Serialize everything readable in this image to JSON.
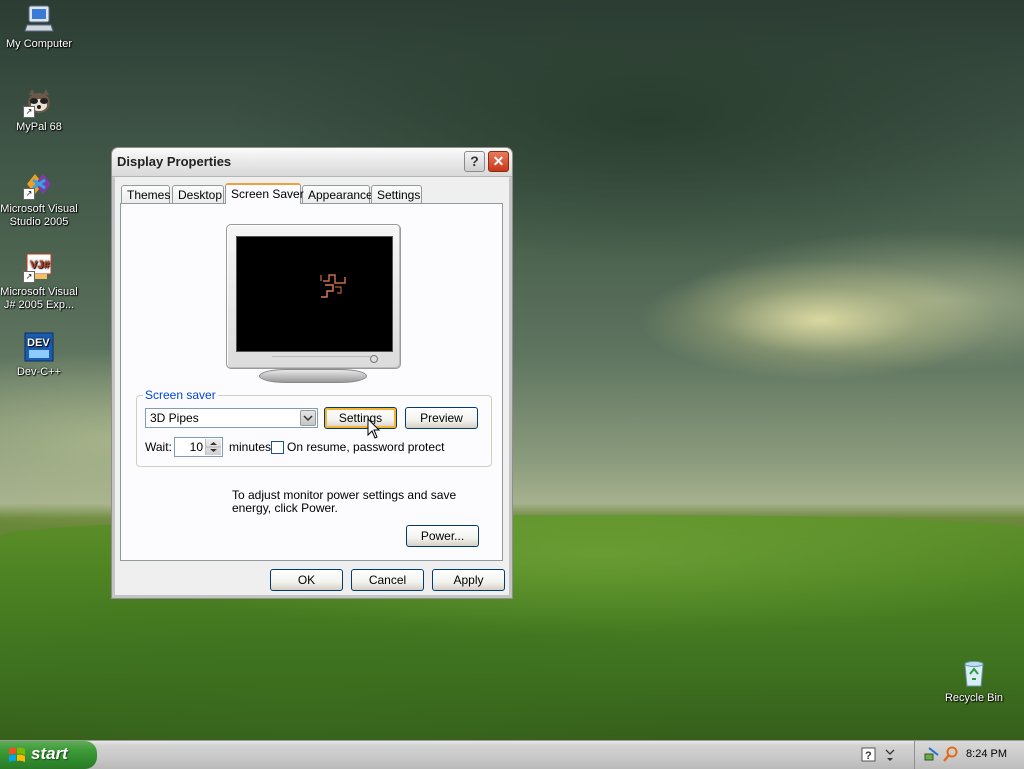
{
  "desktop": {
    "icons": [
      {
        "label": "My Computer",
        "icon": "my-computer-icon"
      },
      {
        "label": "MyPal 68",
        "icon": "mypal-icon"
      },
      {
        "label": "Microsoft Visual Studio 2005",
        "icon": "visual-studio-icon"
      },
      {
        "label": "Microsoft Visual J# 2005 Exp...",
        "icon": "vjsharp-icon"
      },
      {
        "label": "Dev-C++",
        "icon": "devcpp-icon"
      },
      {
        "label": "Recycle Bin",
        "icon": "recycle-bin-icon"
      }
    ]
  },
  "dialog": {
    "title": "Display Properties",
    "help_glyph": "?",
    "close_glyph": "✕",
    "tabs": [
      "Themes",
      "Desktop",
      "Screen Saver",
      "Appearance",
      "Settings"
    ],
    "active_tab": "Screen Saver",
    "screensaver_group": {
      "legend": "Screen saver",
      "selected": "3D Pipes",
      "settings_label": "Settings",
      "preview_label": "Preview",
      "wait_label": "Wait:",
      "wait_value": "10",
      "minutes_label": "minutes",
      "password_label": "On resume, password protect",
      "password_checked": false
    },
    "power": {
      "text": "To adjust monitor power settings and save energy, click Power.",
      "button_label": "Power..."
    },
    "buttons": {
      "ok": "OK",
      "cancel": "Cancel",
      "apply": "Apply"
    }
  },
  "taskbar": {
    "start_label": "start",
    "clock": "8:24 PM"
  },
  "colors": {
    "accent_tab": "#e8a33d",
    "group_legend": "#0046d5",
    "start_green": "#3c9a37",
    "close_red": "#c8381a"
  }
}
